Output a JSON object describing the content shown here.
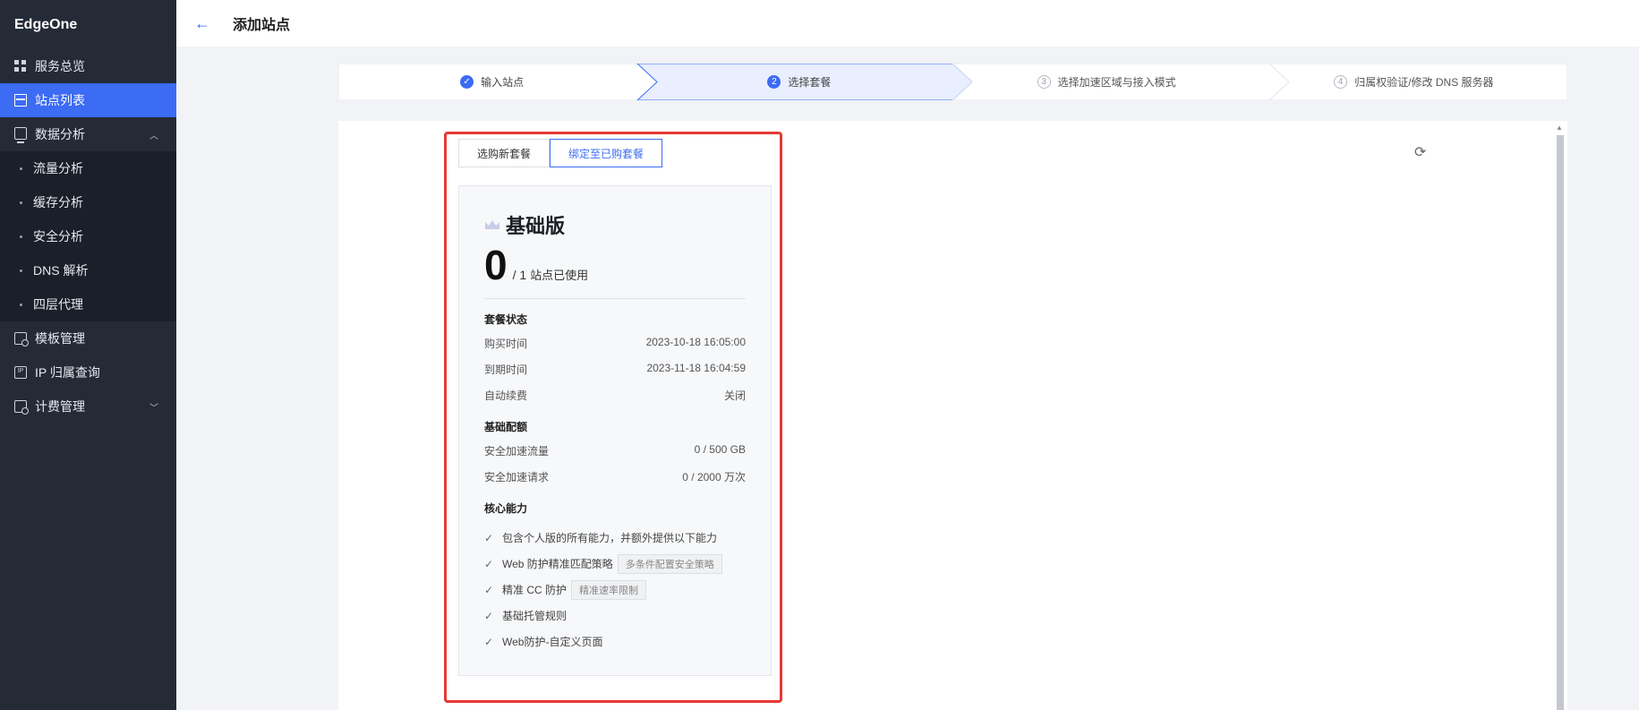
{
  "app": {
    "brand": "EdgeOne"
  },
  "sidebar": {
    "items": [
      {
        "label": "服务总览",
        "icon": "grid-icon"
      },
      {
        "label": "站点列表",
        "icon": "list-icon",
        "active": true
      },
      {
        "label": "数据分析",
        "icon": "monitor-icon",
        "expanded": true
      },
      {
        "label": "模板管理",
        "icon": "template-icon"
      },
      {
        "label": "IP 归属查询",
        "icon": "ip-icon"
      },
      {
        "label": "计费管理",
        "icon": "bill-icon"
      }
    ],
    "sub_items": [
      "流量分析",
      "缓存分析",
      "安全分析",
      "DNS 解析",
      "四层代理"
    ]
  },
  "header": {
    "title": "添加站点",
    "back_icon": "arrow-left-icon"
  },
  "steps": [
    {
      "num": "✓",
      "label": "输入站点",
      "state": "done"
    },
    {
      "num": "2",
      "label": "选择套餐",
      "state": "current"
    },
    {
      "num": "3",
      "label": "选择加速区域与接入模式",
      "state": "todo"
    },
    {
      "num": "4",
      "label": "归属权验证/修改 DNS 服务器",
      "state": "todo"
    }
  ],
  "tabs": {
    "new": "选购新套餐",
    "bind": "绑定至已购套餐"
  },
  "plan": {
    "name": "基础版",
    "used": "0",
    "total": "/ 1",
    "usage_text": "站点已使用",
    "status_title": "套餐状态",
    "status": [
      {
        "label": "购买时间",
        "value": "2023-10-18 16:05:00"
      },
      {
        "label": "到期时间",
        "value": "2023-11-18 16:04:59"
      },
      {
        "label": "自动续费",
        "value": "关闭"
      }
    ],
    "quota_title": "基础配额",
    "quota": [
      {
        "label": "安全加速流量",
        "value": "0 / 500 GB"
      },
      {
        "label": "安全加速请求",
        "value": "0 / 2000 万次"
      }
    ],
    "capabilities_title": "核心能力",
    "capabilities": [
      {
        "text": "包含个人版的所有能力，并额外提供以下能力",
        "tag": ""
      },
      {
        "text": "Web 防护精准匹配策略",
        "tag": "多条件配置安全策略"
      },
      {
        "text": "精准 CC 防护",
        "tag": "精准速率限制"
      },
      {
        "text": "基础托管规则",
        "tag": ""
      },
      {
        "text": "Web防护-自定义页面",
        "tag": ""
      }
    ]
  },
  "colors": {
    "accent": "#3c6bf4",
    "sidebar_bg": "#252a37",
    "highlight": "#e53935"
  }
}
